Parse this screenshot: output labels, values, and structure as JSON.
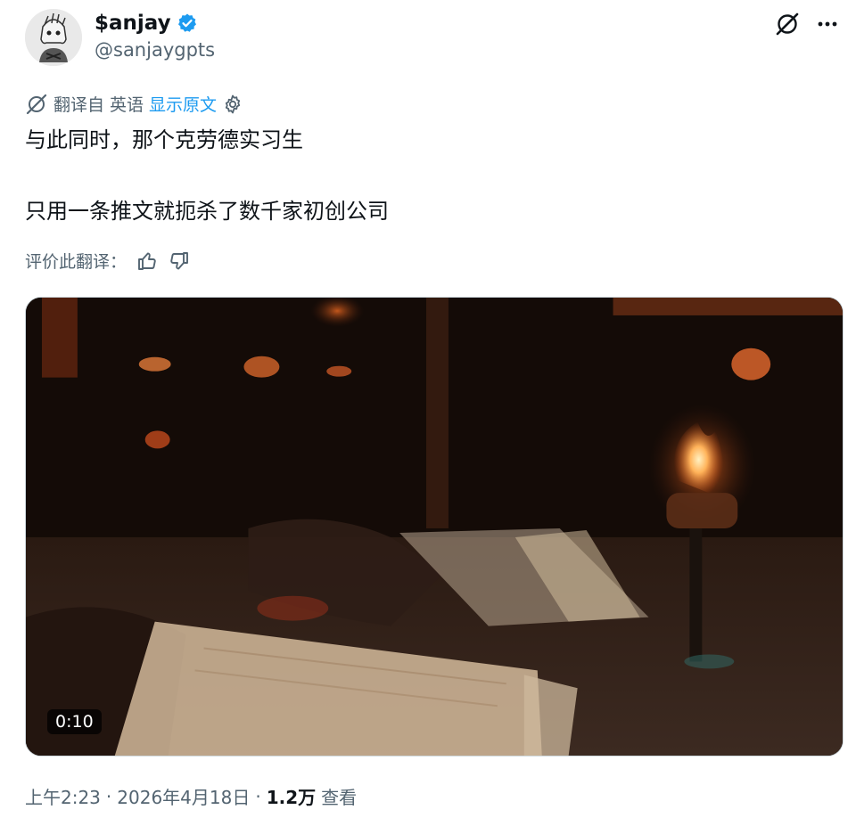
{
  "author": {
    "name": "$anjay",
    "handle": "@sanjaygpts",
    "verified": true
  },
  "translation": {
    "translated_from": "翻译自 英语",
    "show_original": "显示原文",
    "rate_label": "评价此翻译："
  },
  "tweet": {
    "line1": "与此同时，那个克劳德实习生",
    "line2": "只用一条推文就扼杀了数千家初创公司"
  },
  "media": {
    "duration": "0:10"
  },
  "meta": {
    "time": "上午2:23",
    "date": "2026年4月18日",
    "views_count": "1.2万",
    "views_label": "查看",
    "separator": "·"
  },
  "icons": {
    "grok": "grok-icon",
    "more": "more-icon",
    "translate": "translate-icon",
    "settings": "gear-icon",
    "thumbs_up": "thumbs-up-icon",
    "thumbs_down": "thumbs-down-icon",
    "verified": "verified-badge-icon"
  },
  "colors": {
    "accent": "#1d9bf0",
    "text_secondary": "#536471",
    "text_primary": "#0f1419"
  }
}
